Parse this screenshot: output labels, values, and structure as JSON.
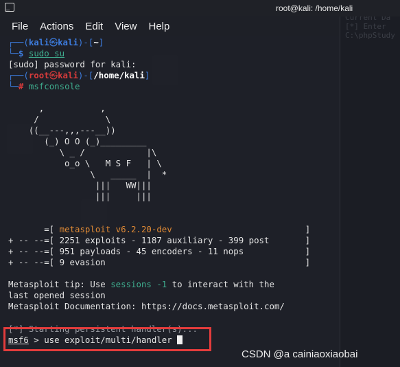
{
  "window": {
    "title": "root@kali: /home/kali",
    "icon": "terminal-icon"
  },
  "menu": {
    "items": [
      "File",
      "Actions",
      "Edit",
      "View",
      "Help"
    ]
  },
  "background": {
    "right_panel_text": "Action  In\nCurrent Da\n[*] Enter\nC:\\phpStudy"
  },
  "terminal": {
    "p1_open": "┌──(",
    "p1_user": "kali",
    "p1_at": "㉿",
    "p1_host": "kali",
    "p1_mid": ")-[",
    "p1_dir": "~",
    "p1_close": "]",
    "p1b_prefix": "└─",
    "p1b_symbol": "$",
    "cmd1": "sudo su",
    "sudo_prompt": "[sudo] password for kali:",
    "p2_open": "┌──(",
    "p2_user": "root",
    "p2_at": "㉿",
    "p2_host": "kali",
    "p2_mid": ")-[",
    "p2_dir": "/home/kali",
    "p2_close": "]",
    "p2b_prefix": "└─",
    "p2b_symbol": "#",
    "cmd2": "msfconsole",
    "art": [
      "      ,           ,",
      "     /             \\",
      "    ((__---,,,---__))",
      "       (_) O O (_)_________",
      "          \\ _ /            |\\",
      "           o_o \\   M S F   | \\",
      "                \\   _____  |  *",
      "                 |||   WW|||",
      "                 |||     |||"
    ],
    "banner_prefix": "       =[ ",
    "banner_name": "metasploit v6.2.20-dev",
    "banner_suffix": "                          ]",
    "stats": [
      "+ -- --=[ 2251 exploits - 1187 auxiliary - 399 post       ]",
      "+ -- --=[ 951 payloads - 45 encoders - 11 nops            ]",
      "+ -- --=[ 9 evasion                                       ]"
    ],
    "tip_prefix": "Metasploit tip: Use ",
    "tip_keyword": "sessions -1",
    "tip_suffix": " to interact with the",
    "tip_line2": "last opened session",
    "docs": "Metasploit Documentation: https://docs.metasploit.com/",
    "starting": "[*] Starting persistent handler(s)...",
    "msf_prompt": "msf6",
    "msf_command": " > use exploit/multi/handler "
  },
  "watermark": "CSDN @a cainiaoxiaobai",
  "colors": {
    "prompt_blue": "#3d7de0",
    "root_red": "#d73b3b",
    "highlight_red": "#e43c3c",
    "banner_orange": "#e08a35",
    "keyword_green": "#3fae8f"
  }
}
